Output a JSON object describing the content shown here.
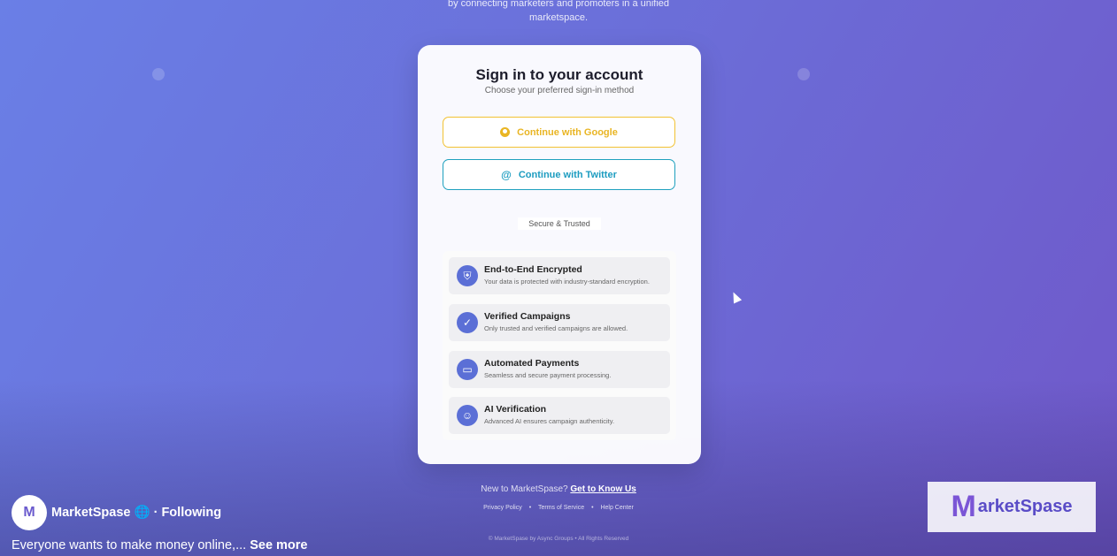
{
  "hero": {
    "tagline_line1": "by connecting marketers and promoters in a unified",
    "tagline_line2": "marketspace."
  },
  "card": {
    "title": "Sign in to your account",
    "subtitle": "Choose your preferred sign-in method",
    "google_label": "Continue with Google",
    "twitter_label": "Continue with Twitter",
    "divider": "Secure & Trusted",
    "features": [
      {
        "title": "End-to-End Encrypted",
        "desc": "Your data is protected with industry-standard encryption.",
        "icon": "shield-icon"
      },
      {
        "title": "Verified Campaigns",
        "desc": "Only trusted and verified campaigns are allowed.",
        "icon": "verified-icon"
      },
      {
        "title": "Automated Payments",
        "desc": "Seamless and secure payment processing.",
        "icon": "card-icon"
      },
      {
        "title": "AI Verification",
        "desc": "Advanced AI ensures campaign authenticity.",
        "icon": "robot-icon"
      }
    ]
  },
  "footer": {
    "new_to": "New to MarketSpase?",
    "get_to_know": "Get to Know Us",
    "links": [
      "Privacy Policy",
      "Terms of Service",
      "Help Center"
    ],
    "copyright": "© MarketSpase by Async Groups  •  All Rights Reserved"
  },
  "overlay": {
    "page_name": "MarketSpase",
    "following": "· Following",
    "caption": "Everyone wants to make money online,...",
    "see_more": "See more",
    "watermark_m": "M",
    "watermark_text": "arketSpase",
    "avatar_letter": "M"
  },
  "colors": {
    "google": "#e9b523",
    "twitter": "#1c9cc0",
    "accent": "#5b6fd6"
  }
}
